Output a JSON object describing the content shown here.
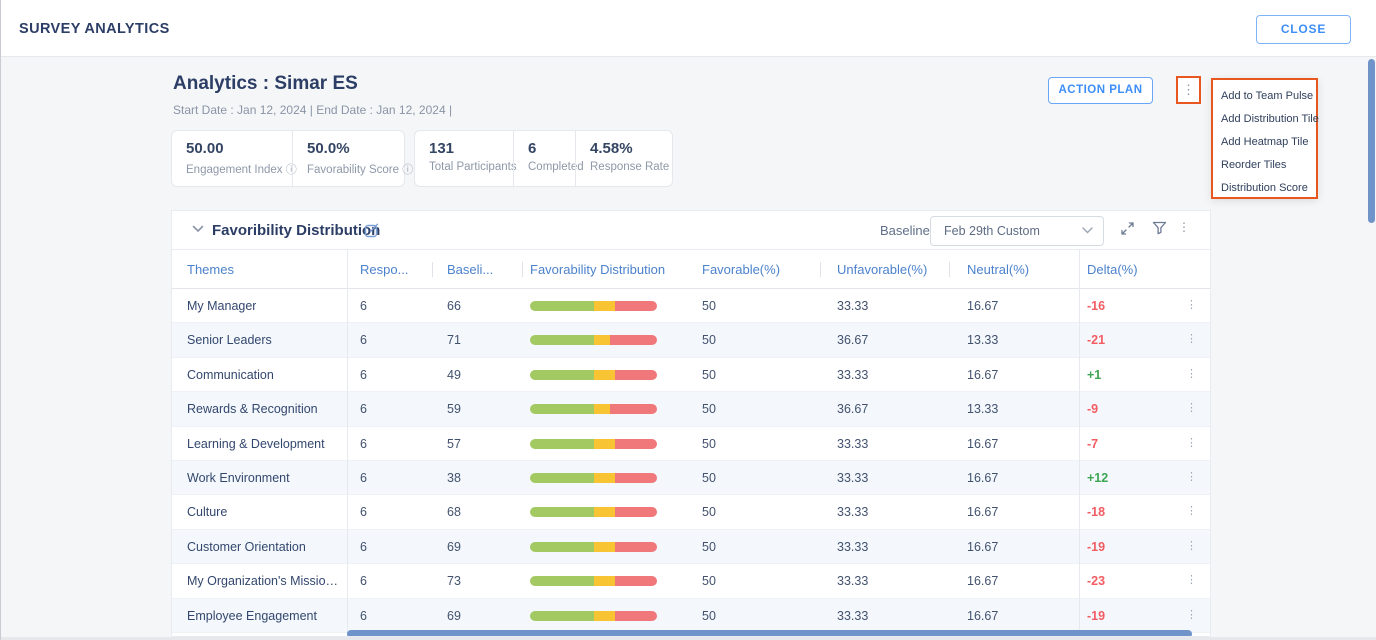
{
  "topbar": {
    "title": "SURVEY ANALYTICS",
    "close_label": "CLOSE"
  },
  "header": {
    "title": "Analytics : Simar ES",
    "dates_line": "Start Date : Jan 12, 2024    |    End Date : Jan 12, 2024    |",
    "action_plan_label": "ACTION PLAN"
  },
  "stats": {
    "card1": [
      {
        "value": "50.00",
        "label": "Engagement Index",
        "info": true
      },
      {
        "value": "50.0%",
        "label": "Favorability Score",
        "info": true
      }
    ],
    "card2": [
      {
        "value": "131",
        "label": "Total Participants",
        "info": false
      },
      {
        "value": "6",
        "label": "Completed",
        "info": false
      },
      {
        "value": "4.58%",
        "label": "Response Rate",
        "info": false
      }
    ]
  },
  "menu": {
    "items": [
      "Add to Team Pulse",
      "Add Distribution Tile",
      "Add Heatmap Tile",
      "Reorder Tiles",
      "Distribution Score"
    ]
  },
  "section": {
    "title": "Favoribility Distribution",
    "baseline_label": "Baseline",
    "baseline_value": "Feb 29th Custom"
  },
  "table": {
    "columns": [
      "Themes",
      "Respo...",
      "Baseli...",
      "Favorability Distribution",
      "Favorable(%)",
      "Unfavorable(%)",
      "Neutral(%)",
      "Delta(%)"
    ],
    "rows": [
      {
        "theme": "My Manager",
        "responses": "6",
        "baseline": "66",
        "favorable": "50",
        "unfavorable": "33.33",
        "neutral": "16.67",
        "delta": "-16"
      },
      {
        "theme": "Senior Leaders",
        "responses": "6",
        "baseline": "71",
        "favorable": "50",
        "unfavorable": "36.67",
        "neutral": "13.33",
        "delta": "-21"
      },
      {
        "theme": "Communication",
        "responses": "6",
        "baseline": "49",
        "favorable": "50",
        "unfavorable": "33.33",
        "neutral": "16.67",
        "delta": "+1"
      },
      {
        "theme": "Rewards & Recognition",
        "responses": "6",
        "baseline": "59",
        "favorable": "50",
        "unfavorable": "36.67",
        "neutral": "13.33",
        "delta": "-9"
      },
      {
        "theme": "Learning & Development",
        "responses": "6",
        "baseline": "57",
        "favorable": "50",
        "unfavorable": "33.33",
        "neutral": "16.67",
        "delta": "-7"
      },
      {
        "theme": "Work Environment",
        "responses": "6",
        "baseline": "38",
        "favorable": "50",
        "unfavorable": "33.33",
        "neutral": "16.67",
        "delta": "+12"
      },
      {
        "theme": "Culture",
        "responses": "6",
        "baseline": "68",
        "favorable": "50",
        "unfavorable": "33.33",
        "neutral": "16.67",
        "delta": "-18"
      },
      {
        "theme": "Customer Orientation",
        "responses": "6",
        "baseline": "69",
        "favorable": "50",
        "unfavorable": "33.33",
        "neutral": "16.67",
        "delta": "-19"
      },
      {
        "theme": "My Organization's Mission, Va...",
        "responses": "6",
        "baseline": "73",
        "favorable": "50",
        "unfavorable": "33.33",
        "neutral": "16.67",
        "delta": "-23"
      },
      {
        "theme": "Employee Engagement",
        "responses": "6",
        "baseline": "69",
        "favorable": "50",
        "unfavorable": "33.33",
        "neutral": "16.67",
        "delta": "-19"
      }
    ]
  },
  "icons": {
    "kebab": "⋮",
    "info": "ⓘ"
  },
  "colors": {
    "navy": "#2c3e66",
    "accent-blue": "#3e8ef7",
    "header-blue": "#4c82cc",
    "orange": "#e8571f",
    "bar-green": "#a3c963",
    "bar-yellow": "#f9c433",
    "bar-red": "#f0777a",
    "delta-neg": "#f25c62",
    "delta-pos": "#3da554",
    "scrollbar": "#7094ca",
    "stripe": "#f4f8fc"
  }
}
